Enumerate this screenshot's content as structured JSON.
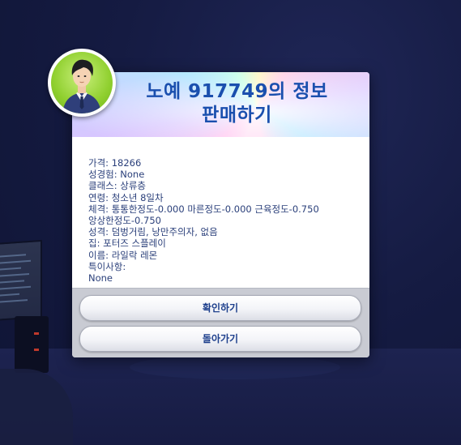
{
  "dialog": {
    "title_line1": "노예 917749의 정보",
    "title_line2": "판매하기",
    "info_lines": [
      "가격: 18266",
      "성경험: None",
      "클래스: 상류층",
      "연령: 청소년 8일차",
      "체격: 통통한정도-0.000 마른정도-0.000 근육정도-0.750",
      "앙상한정도-0.750",
      "성격: 덤벙거림, 낭만주의자, 없음",
      "집: 포터즈 스플레이",
      "이름: 라일락 레몬",
      "특이사항:",
      "None"
    ],
    "confirm_label": "확인하기",
    "back_label": "돌아가기"
  },
  "avatar": {
    "icon": "sim-portrait-icon",
    "background_color": "#8fcf2e"
  },
  "colors": {
    "title": "#1a4fae",
    "body_text": "#2a3f7a",
    "button_text": "#1d3f8c",
    "footer": "#c9cbd3",
    "background": "#151b42"
  }
}
